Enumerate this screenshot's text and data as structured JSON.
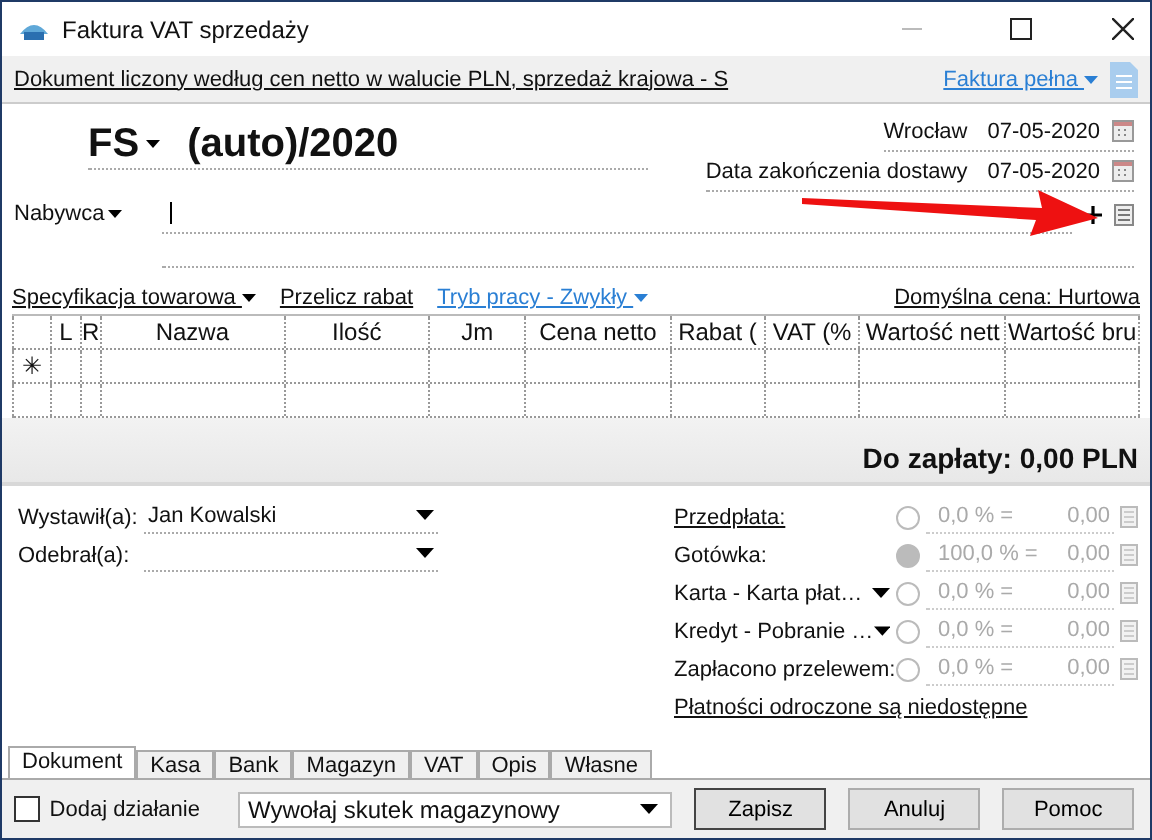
{
  "window": {
    "title": "Faktura VAT sprzedaży"
  },
  "info_bar": {
    "text": "Dokument liczony według cen netto w walucie PLN, sprzedaż krajowa - S",
    "document_type": "Faktura pełna"
  },
  "header": {
    "series": "FS",
    "number": "(auto)/2020",
    "place_label": "Wrocław",
    "issue_date": "07-05-2020",
    "delivery_label": "Data zakończenia dostawy",
    "delivery_date": "07-05-2020",
    "buyer_label": "Nabywca"
  },
  "toolbar": {
    "specification": "Specyfikacja towarowa",
    "recalc": "Przelicz rabat",
    "mode": "Tryb pracy - Zwykły",
    "default_price": "Domyślna cena: Hurtowa"
  },
  "table": {
    "columns": [
      "L",
      "R",
      "Nazwa",
      "Ilość",
      "Jm",
      "Cena netto",
      "Rabat (",
      "VAT (%",
      "Wartość nett",
      "Wartość bru"
    ],
    "new_row_marker": "✳"
  },
  "total": "Do zapłaty: 0,00 PLN",
  "people": [
    {
      "label": "Wystawił(a):",
      "value": "Jan Kowalski"
    },
    {
      "label": "Odebrał(a):"
    }
  ],
  "payments": [
    {
      "label": "Przedpłata:",
      "kind": "link",
      "selected": false,
      "percent": "0,0 % =",
      "amount": "0,00"
    },
    {
      "label": "Gotówka:",
      "kind": "plain",
      "selected": true,
      "percent": "100,0 % =",
      "amount": "0,00"
    },
    {
      "label": "Karta - Karta płat…",
      "kind": "dropdown",
      "selected": false,
      "percent": "0,0 % =",
      "amount": "0,00"
    },
    {
      "label": "Kredyt - Pobranie …",
      "kind": "dropdown",
      "selected": false,
      "percent": "0,0 % =",
      "amount": "0,00"
    },
    {
      "label": "Zapłacono przelewem:",
      "kind": "plain",
      "selected": false,
      "percent": "0,0 % =",
      "amount": "0,00"
    }
  ],
  "deferred_link": "Płatności odroczone są niedostępne",
  "tabs": [
    {
      "label": "Dokument",
      "selected": true
    },
    {
      "label": "Kasa",
      "selected": false
    },
    {
      "label": "Bank",
      "selected": false
    },
    {
      "label": "Magazyn",
      "selected": false
    },
    {
      "label": "VAT",
      "selected": false
    },
    {
      "label": "Opis",
      "selected": false
    },
    {
      "label": "Własne",
      "selected": false
    }
  ],
  "footer": {
    "add_action": {
      "label": "Dodaj działanie",
      "checked": false
    },
    "stock_effect": "Wywołaj skutek magazynowy",
    "buttons": [
      "Zapisz",
      "Anuluj",
      "Pomoc"
    ]
  }
}
